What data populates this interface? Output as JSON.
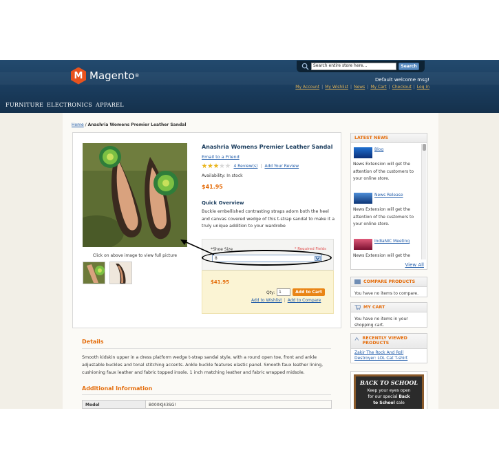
{
  "header": {
    "logo_text": "Magento",
    "logo_letter": "M",
    "logo_reg": "®",
    "search_placeholder": "Search entire store here...",
    "search_button": "Search",
    "welcome": "Default welcome msg!",
    "top_links": [
      "My Account",
      "My Wishlist",
      "News",
      "My Cart",
      "Checkout",
      "Log In"
    ]
  },
  "nav": {
    "items": [
      "FURNITURE",
      "ELECTRONICS",
      "APPAREL"
    ]
  },
  "breadcrumb": {
    "home": "Home",
    "separator": " / ",
    "current": "Anashria Womens Premier Leather Sandal"
  },
  "product": {
    "name": "Anashria Womens Premier Leather Sandal",
    "email_friend": "Email to a Friend",
    "rating_stars": 3,
    "rating_max": 5,
    "reviews_link": "4 Review(s)",
    "add_review_link": "Add Your Review",
    "availability": "Availability: In stock",
    "price": "$41.95",
    "overview_title": "Quick Overview",
    "overview_text": "Buckle embellished contrasting straps adorn both the heel and canvas covered wedge of this t-strap sandal to make it a truly unique addition to your wardrobe",
    "image_caption": "Click on above image to view full picture",
    "options": {
      "label": "*Shoe Size",
      "required_note": "* Required Fields",
      "selected_value": "8"
    },
    "cart": {
      "price": "$41.95",
      "qty_label": "Qty:",
      "qty_value": "1",
      "add_button": "Add to Cart",
      "wishlist_link": "Add to Wishlist",
      "compare_link": "Add to Compare",
      "link_separator": "|"
    }
  },
  "details": {
    "title": "Details",
    "text": "Smooth kidskin upper in a dress platform wedge t-strap sandal style, with a round open toe, front and ankle adjustable buckles and tonal stitching accents. Ankle buckle features elastic panel. Smooth faux leather lining, cushioning faux leather and fabric topped insole. 1 inch matching leather and fabric wrapped midsole."
  },
  "additional_info": {
    "title": "Additional Information",
    "rows": [
      {
        "key": "Model",
        "value": "B000KJ43SG!"
      }
    ]
  },
  "sidebar": {
    "news": {
      "title": "LATEST NEWS",
      "items": [
        {
          "title": "Blog",
          "text": "News Extension will get the attention of the customers to your online store."
        },
        {
          "title": "News Release",
          "text": "News Extension will get the attention of the customers to your online store."
        },
        {
          "title": "IndiaNIC Meeting",
          "text": "News Extension will get the"
        }
      ],
      "view_all": "View All"
    },
    "compare": {
      "title": "COMPARE PRODUCTS",
      "text": "You have no items to compare."
    },
    "cart": {
      "title": "MY CART",
      "text": "You have no items in your shopping cart."
    },
    "recent": {
      "title": "RECENTLY VIEWED PRODUCTS",
      "link": "Zakir The Rock And Roll Destroyer: LOL Cat T-shirt"
    },
    "promo": {
      "title": "BACK TO SCHOOL",
      "line1": "Keep your eyes open",
      "line2": "for our special",
      "line2b": "Back",
      "line3": "to School",
      "line3b": "sale"
    }
  },
  "colors": {
    "header_bg": "#1a3c5d",
    "accent": "#e46c0a",
    "link": "#1e5aa8",
    "button": "#e98516"
  }
}
